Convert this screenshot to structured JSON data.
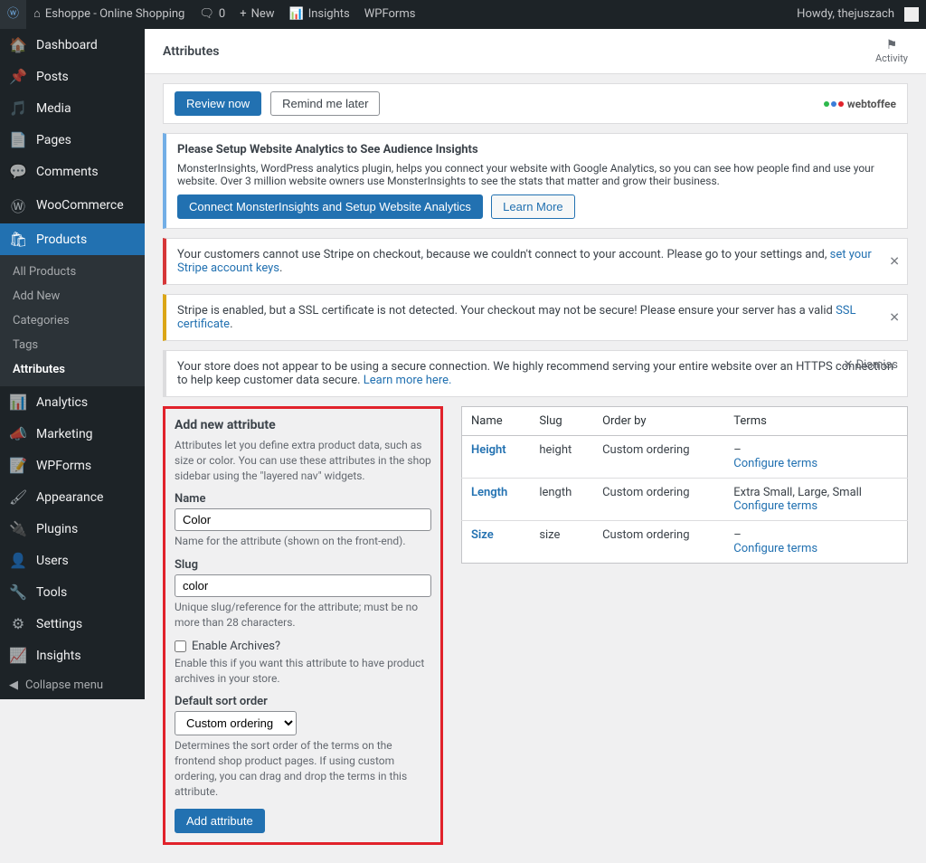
{
  "adminbar": {
    "site_name": "Eshoppe - Online Shopping",
    "comments_count": "0",
    "new_label": "New",
    "insights_label": "Insights",
    "wpforms_label": "WPForms",
    "howdy": "Howdy, thejuszach"
  },
  "menu": {
    "dashboard": "Dashboard",
    "posts": "Posts",
    "media": "Media",
    "pages": "Pages",
    "comments": "Comments",
    "woocommerce": "WooCommerce",
    "products": "Products",
    "products_sub": {
      "all": "All Products",
      "add": "Add New",
      "categories": "Categories",
      "tags": "Tags",
      "attributes": "Attributes"
    },
    "analytics": "Analytics",
    "marketing": "Marketing",
    "wpforms": "WPForms",
    "appearance": "Appearance",
    "plugins": "Plugins",
    "users": "Users",
    "tools": "Tools",
    "settings": "Settings",
    "insights": "Insights",
    "collapse": "Collapse menu"
  },
  "page": {
    "title": "Attributes",
    "activity": "Activity"
  },
  "review": {
    "review_now": "Review now",
    "remind_later": "Remind me later",
    "brand": "webtoffee"
  },
  "insights": {
    "title": "Please Setup Website Analytics to See Audience Insights",
    "body": "MonsterInsights, WordPress analytics plugin, helps you connect your website with Google Analytics, so you can see how people find and use your website. Over 3 million website owners use MonsterInsights to see the stats that matter and grow their business.",
    "btn_connect": "Connect MonsterInsights and Setup Website Analytics",
    "btn_learn": "Learn More"
  },
  "stripe_notice": {
    "text_a": "Your customers cannot use Stripe on checkout, because we couldn't connect to your account. Please go to your settings and, ",
    "link": "set your Stripe account keys",
    "text_b": "."
  },
  "ssl_notice": {
    "text_a": "Stripe is enabled, but a SSL certificate is not detected. Your checkout may not be secure! Please ensure your server has a valid ",
    "link": "SSL certificate",
    "text_b": "."
  },
  "secure_notice": {
    "text": "Your store does not appear to be using a secure connection. We highly recommend serving your entire website over an HTTPS connection to help keep customer data secure. ",
    "link": "Learn more here.",
    "dismiss": "Dismiss"
  },
  "form": {
    "heading": "Add new attribute",
    "intro": "Attributes let you define extra product data, such as size or color. You can use these attributes in the shop sidebar using the \"layered nav\" widgets.",
    "name_label": "Name",
    "name_value": "Color",
    "name_help": "Name for the attribute (shown on the front-end).",
    "slug_label": "Slug",
    "slug_value": "color",
    "slug_help": "Unique slug/reference for the attribute; must be no more than 28 characters.",
    "archives_label": "Enable Archives?",
    "archives_help": "Enable this if you want this attribute to have product archives in your store.",
    "order_label": "Default sort order",
    "order_value": "Custom ordering",
    "order_help": "Determines the sort order of the terms on the frontend shop product pages. If using custom ordering, you can drag and drop the terms in this attribute.",
    "submit": "Add attribute"
  },
  "table": {
    "h_name": "Name",
    "h_slug": "Slug",
    "h_order": "Order by",
    "h_terms": "Terms",
    "configure": "Configure terms",
    "rows": [
      {
        "name": "Height",
        "slug": "height",
        "order": "Custom ordering",
        "terms": "–"
      },
      {
        "name": "Length",
        "slug": "length",
        "order": "Custom ordering",
        "terms": "Extra Small, Large, Small"
      },
      {
        "name": "Size",
        "slug": "size",
        "order": "Custom ordering",
        "terms": "–"
      }
    ]
  }
}
